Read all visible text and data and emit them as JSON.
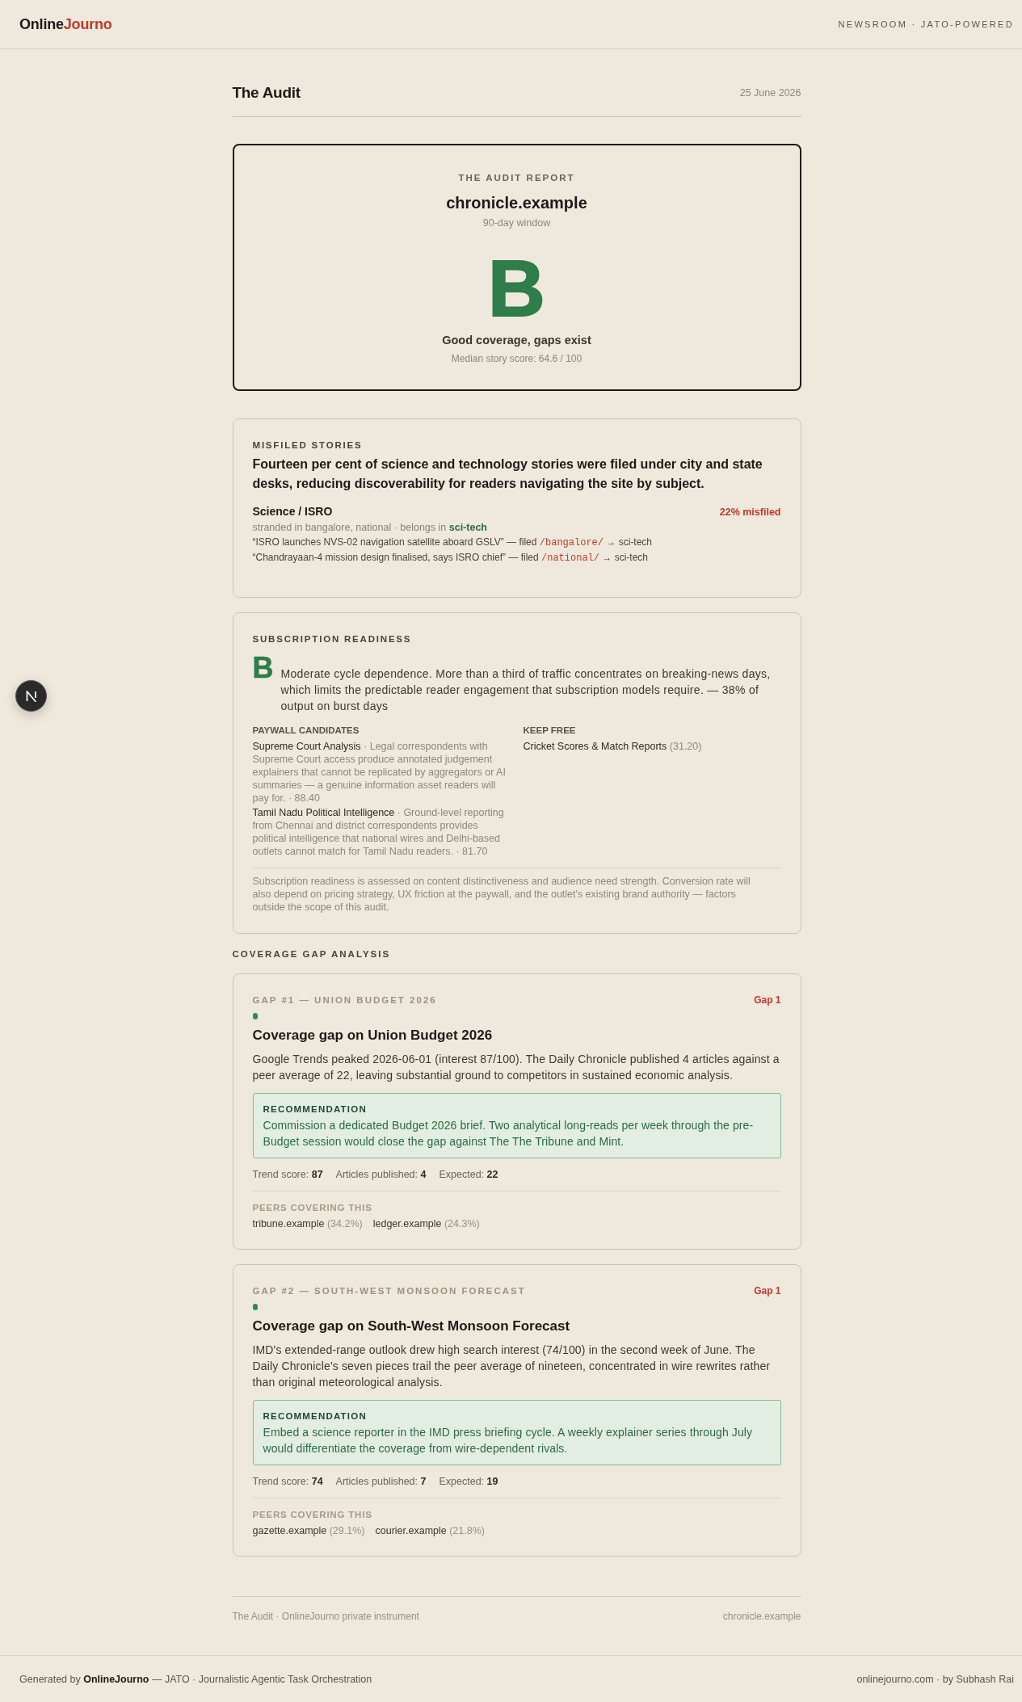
{
  "header": {
    "logo": {
      "text": "Online",
      "accent": "Journo"
    },
    "tagline": "NEWSROOM · JATO-POWERED"
  },
  "page": {
    "title": "The Audit",
    "date": "25 June 2026"
  },
  "report": {
    "eyebrow": "THE AUDIT REPORT",
    "site": "chronicle.example",
    "window": "90-day window",
    "grade": "B",
    "verdict": "Good coverage, gaps exist",
    "median": "Median story score: 64.6 / 100"
  },
  "misfiled": {
    "heading": "MISFILED STORIES",
    "summary": "Fourteen per cent of science and technology stories were filed under city and state desks, reducing discoverability for readers navigating the site by subject.",
    "groups": [
      {
        "name": "Science / ISRO",
        "share": "22% misfiled",
        "placement": "stranded in bangalore, national · belongs in **sci-tech**",
        "stories": [
          {
            "title": "“ISRO launches NVS-02 navigation satellite aboard GSLV” — filed",
            "path": "/bangalore/",
            "target": "→ sci-tech"
          },
          {
            "title": "“Chandrayaan-4 mission design finalised, says ISRO chief” — filed",
            "path": "/national/",
            "target": "→ sci-tech"
          }
        ]
      }
    ]
  },
  "subscription": {
    "heading": "SUBSCRIPTION READINESS",
    "grade": "B",
    "summary": "Moderate cycle dependence. More than a third of traffic concentrates on breaking-news days, which limits the predictable reader engagement that subscription models require. — 38% of output on burst days",
    "columns": [
      {
        "heading": "PAYWALL CANDIDATES",
        "items": [
          {
            "name": "Supreme Court Analysis",
            "detail": "· Legal correspondents with Supreme Court access produce annotated judgement explainers that cannot be replicated by aggregators or AI summaries — a genuine information asset readers will pay for. · 88.40"
          },
          {
            "name": "Tamil Nadu Political Intelligence",
            "detail": "· Ground-level reporting from Chennai and district correspondents provides political intelligence that national wires and Delhi-based outlets cannot match for Tamil Nadu readers. · 81.70"
          }
        ]
      },
      {
        "heading": "KEEP FREE",
        "items": [
          {
            "name": "Cricket Scores & Match Reports",
            "detail": "(31.20)"
          }
        ]
      }
    ],
    "note": "Subscription readiness is assessed on content distinctiveness and audience need strength. Conversion rate will also depend on pricing strategy, UX friction at the paywall, and the outlet's existing brand authority — factors outside the scope of this audit."
  },
  "gaps": {
    "heading": "COVERAGE GAP ANALYSIS",
    "items": [
      {
        "label": "GAP #1 — UNION BUDGET 2026",
        "rank": "Gap 1",
        "title": "Coverage gap on Union Budget 2026",
        "body": "Google Trends peaked 2026-06-01 (interest 87/100). The Daily Chronicle published 4 articles against a peer average of 22, leaving substantial ground to competitors in sustained economic analysis.",
        "recommendation": {
          "heading": "RECOMMENDATION",
          "text": "Commission a dedicated Budget 2026 brief. Two analytical long-reads per week through the pre-Budget session would close the gap against The The Tribune and Mint."
        },
        "stats": [
          "Trend score: **87**",
          "Articles published: **4**",
          "Expected: **22**"
        ],
        "peers": {
          "heading": "PEERS COVERING THIS",
          "items": [
            {
              "name": "tribune.example",
              "share": "(34.2%)"
            },
            {
              "name": "ledger.example",
              "share": "(24.3%)"
            }
          ]
        }
      },
      {
        "label": "GAP #2 — SOUTH-WEST MONSOON FORECAST",
        "rank": "Gap 1",
        "title": "Coverage gap on South-West Monsoon Forecast",
        "body": "IMD's extended-range outlook drew high search interest (74/100) in the second week of June. The Daily Chronicle's seven pieces trail the peer average of nineteen, concentrated in wire rewrites rather than original meteorological analysis.",
        "recommendation": {
          "heading": "RECOMMENDATION",
          "text": "Embed a science reporter in the IMD press briefing cycle. A weekly explainer series through July would differentiate the coverage from wire-dependent rivals."
        },
        "stats": [
          "Trend score: **74**",
          "Articles published: **7**",
          "Expected: **19**"
        ],
        "peers": {
          "heading": "PEERS COVERING THIS",
          "items": [
            {
              "name": "gazette.example",
              "share": "(29.1%)"
            },
            {
              "name": "courier.example",
              "share": "(21.8%)"
            }
          ]
        }
      }
    ]
  },
  "footer": {
    "left": "The Audit · OnlineJourno private instrument",
    "right": "chronicle.example"
  },
  "credits": {
    "left": "Generated by **OnlineJourno** — JATO · Journalistic Agentic Task Orchestration",
    "right": "onlinejourno.com · by Subhash Rai"
  }
}
